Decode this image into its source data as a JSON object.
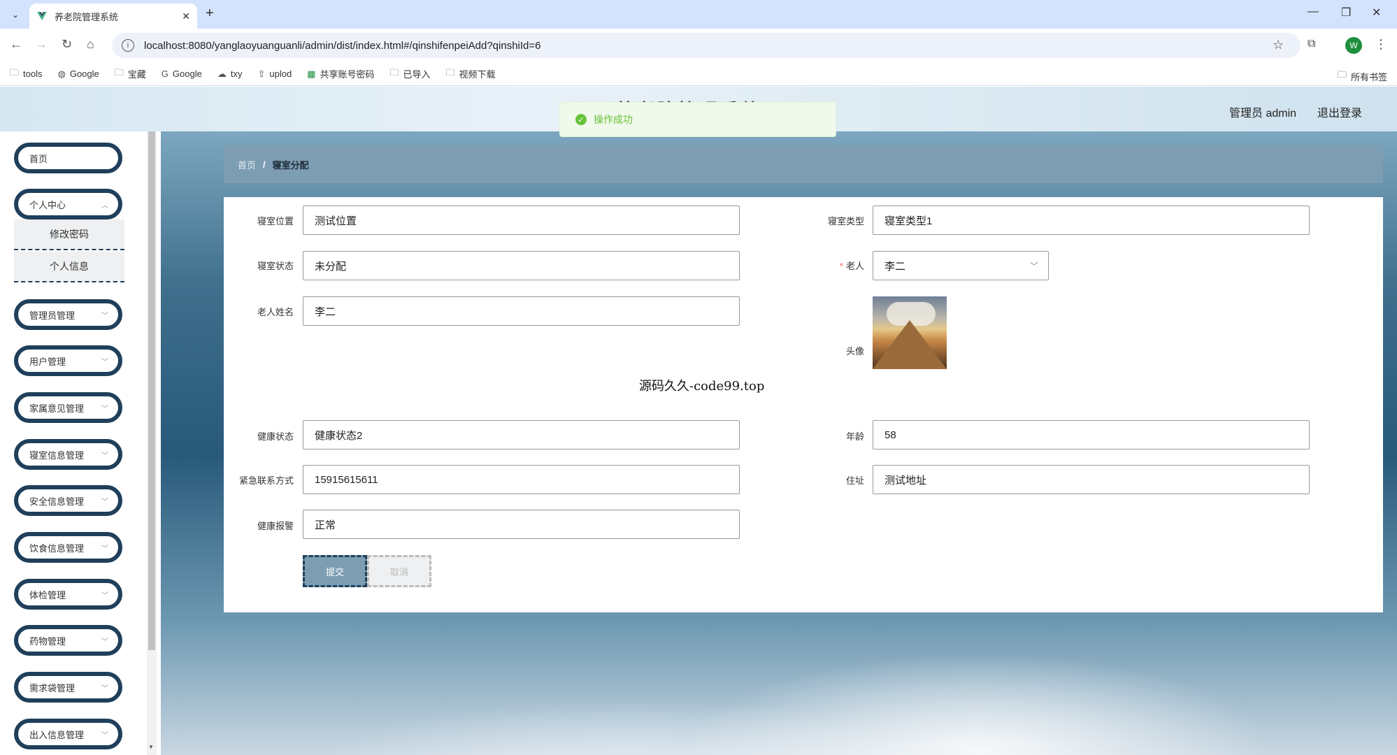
{
  "browser": {
    "tab_title": "养老院管理系统",
    "url": "localhost:8080/yanglaoyuanguanli/admin/dist/index.html#/qinshifenpeiAdd?qinshiId=6",
    "profile_initial": "W",
    "bookmarks": [
      "tools",
      "Google",
      "宝藏",
      "Google",
      "txy",
      "uplod",
      "共享账号密码",
      "已导入",
      "视频下载"
    ],
    "all_bookmarks": "所有书签"
  },
  "header": {
    "title": "养老院管理系统",
    "toast": "操作成功",
    "user": "管理员 admin",
    "logout": "退出登录"
  },
  "sidebar": {
    "items": [
      {
        "label": "首页"
      },
      {
        "label": "个人中心"
      },
      {
        "label": "管理员管理"
      },
      {
        "label": "用户管理"
      },
      {
        "label": "家属意见管理"
      },
      {
        "label": "寝室信息管理"
      },
      {
        "label": "安全信息管理"
      },
      {
        "label": "饮食信息管理"
      },
      {
        "label": "体检管理"
      },
      {
        "label": "药物管理"
      },
      {
        "label": "需求袋管理"
      },
      {
        "label": "出入信息管理"
      }
    ],
    "submenu": [
      "修改密码",
      "个人信息"
    ]
  },
  "breadcrumb": {
    "home": "首页",
    "sep": "/",
    "current": "寝室分配"
  },
  "form": {
    "room_location_label": "寝室位置",
    "room_location": "测试位置",
    "room_type_label": "寝室类型",
    "room_type": "寝室类型1",
    "room_status_label": "寝室状态",
    "room_status": "未分配",
    "elder_label": "老人",
    "elder": "李二",
    "elder_name_label": "老人姓名",
    "elder_name": "李二",
    "avatar_label": "头像",
    "health_label": "健康状态",
    "health": "健康状态2",
    "age_label": "年龄",
    "age": "58",
    "emergency_label": "紧急联系方式",
    "emergency": "15915615611",
    "address_label": "住址",
    "address": "测试地址",
    "alarm_label": "健康报警",
    "alarm": "正常",
    "submit": "提交",
    "cancel": "取消"
  },
  "overlay_text": "源码久久-code99.top"
}
